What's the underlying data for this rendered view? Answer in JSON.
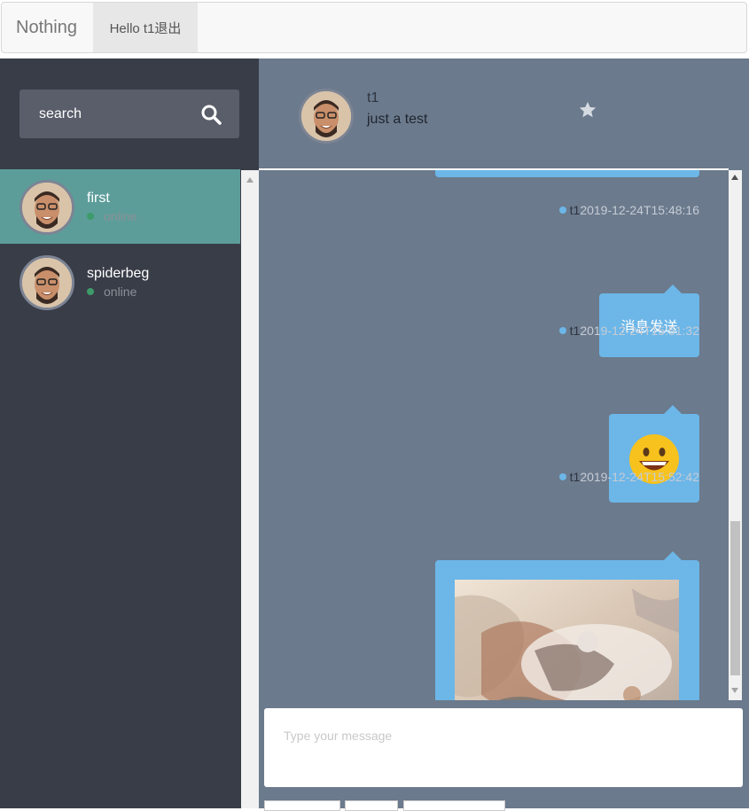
{
  "navbar": {
    "brand": "Nothing",
    "user_link": "Hello t1退出"
  },
  "search": {
    "placeholder": "search"
  },
  "contacts": [
    {
      "name": "first",
      "status": "online"
    },
    {
      "name": "spiderbeg",
      "status": "online"
    }
  ],
  "chat_header": {
    "name": "t1",
    "status": "just a test"
  },
  "messages": [
    {
      "author": "t1",
      "timestamp": "2019-12-24T15:48:16",
      "content": "消息发送"
    },
    {
      "author": "t1",
      "timestamp": "2019-12-24T15:51:32",
      "content": "smiley-emoji"
    },
    {
      "author": "t1",
      "timestamp": "2019-12-24T15:52:42",
      "content": "image"
    }
  ],
  "composer": {
    "placeholder": "Type your message"
  },
  "colors": {
    "sidebar": "#393d48",
    "active_contact": "#5c9d9a",
    "main": "#6b7a8c",
    "bubble": "#6cb6e8"
  }
}
